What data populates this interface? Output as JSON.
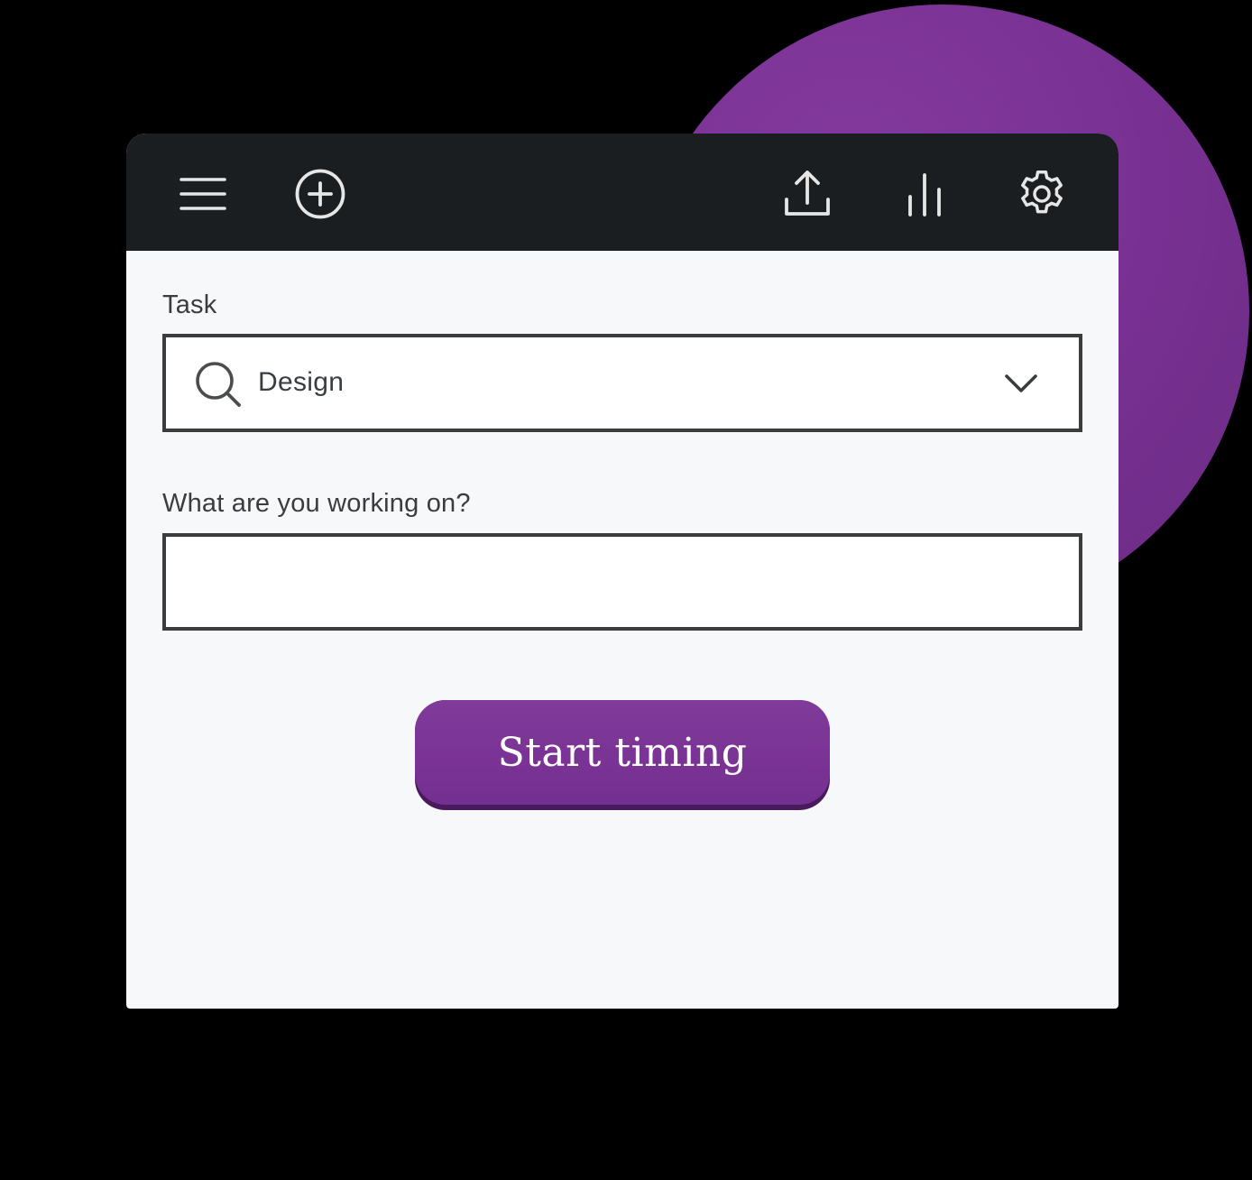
{
  "toolbar": {
    "icons": [
      "menu-icon",
      "add-circle-icon",
      "upload-icon",
      "bar-chart-icon",
      "settings-gear-icon"
    ],
    "icon_color": "#e6e6e6"
  },
  "form": {
    "task_label": "Task",
    "task_value": "Design",
    "work_label": "What are you working on?",
    "work_value": "",
    "work_placeholder": ""
  },
  "start_button": {
    "label": "Start timing"
  },
  "colors": {
    "accent": "#7a3394",
    "toolbar_bg": "#1b1e20",
    "panel_bg": "#f7f8fa",
    "border": "#3a3c3e",
    "page_bg": "#000000"
  }
}
